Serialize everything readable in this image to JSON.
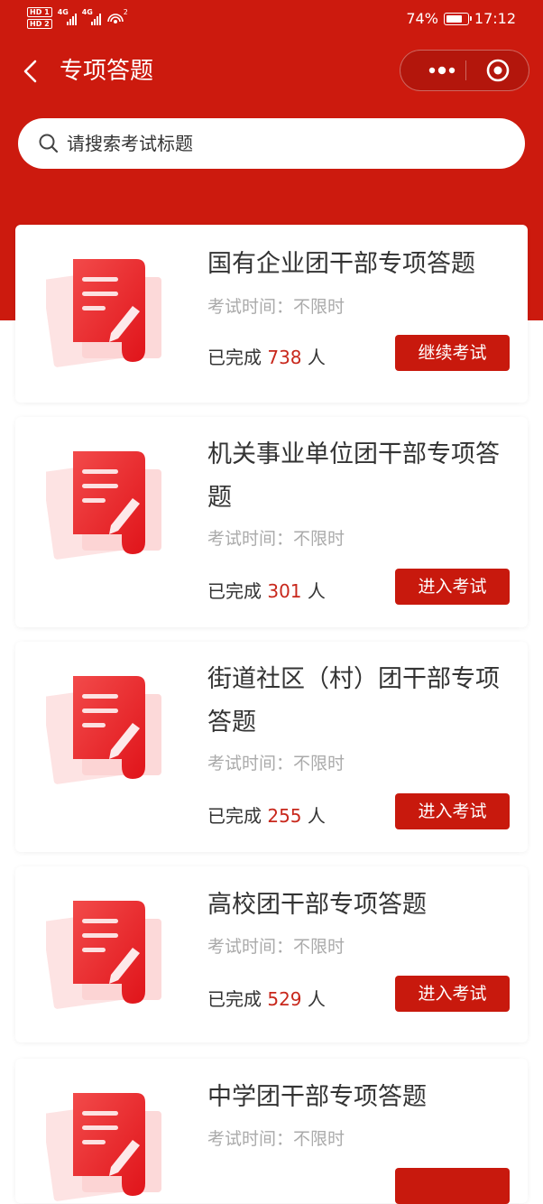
{
  "status_bar": {
    "hd1": "HD 1",
    "hd2": "HD 2",
    "sig1": "4G",
    "sig2": "4G",
    "wifi_sub": "2",
    "battery": "74%",
    "time": "17:12"
  },
  "nav": {
    "title": "专项答题"
  },
  "search": {
    "placeholder": "请搜索考试标题"
  },
  "brand_color": "#cc1a0e",
  "cards": [
    {
      "title": "国有企业团干部专项答题",
      "time_label": "考试时间：不限时",
      "done_prefix": "已完成",
      "count": "738",
      "done_suffix": "人",
      "button": "继续考试"
    },
    {
      "title": "机关事业单位团干部专项答题",
      "time_label": "考试时间：不限时",
      "done_prefix": "已完成",
      "count": "301",
      "done_suffix": "人",
      "button": "进入考试"
    },
    {
      "title": "街道社区（村）团干部专项答题",
      "time_label": "考试时间：不限时",
      "done_prefix": "已完成",
      "count": "255",
      "done_suffix": "人",
      "button": "进入考试"
    },
    {
      "title": "高校团干部专项答题",
      "time_label": "考试时间：不限时",
      "done_prefix": "已完成",
      "count": "529",
      "done_suffix": "人",
      "button": "进入考试"
    },
    {
      "title": "中学团干部专项答题",
      "time_label": "考试时间：不限时"
    }
  ]
}
